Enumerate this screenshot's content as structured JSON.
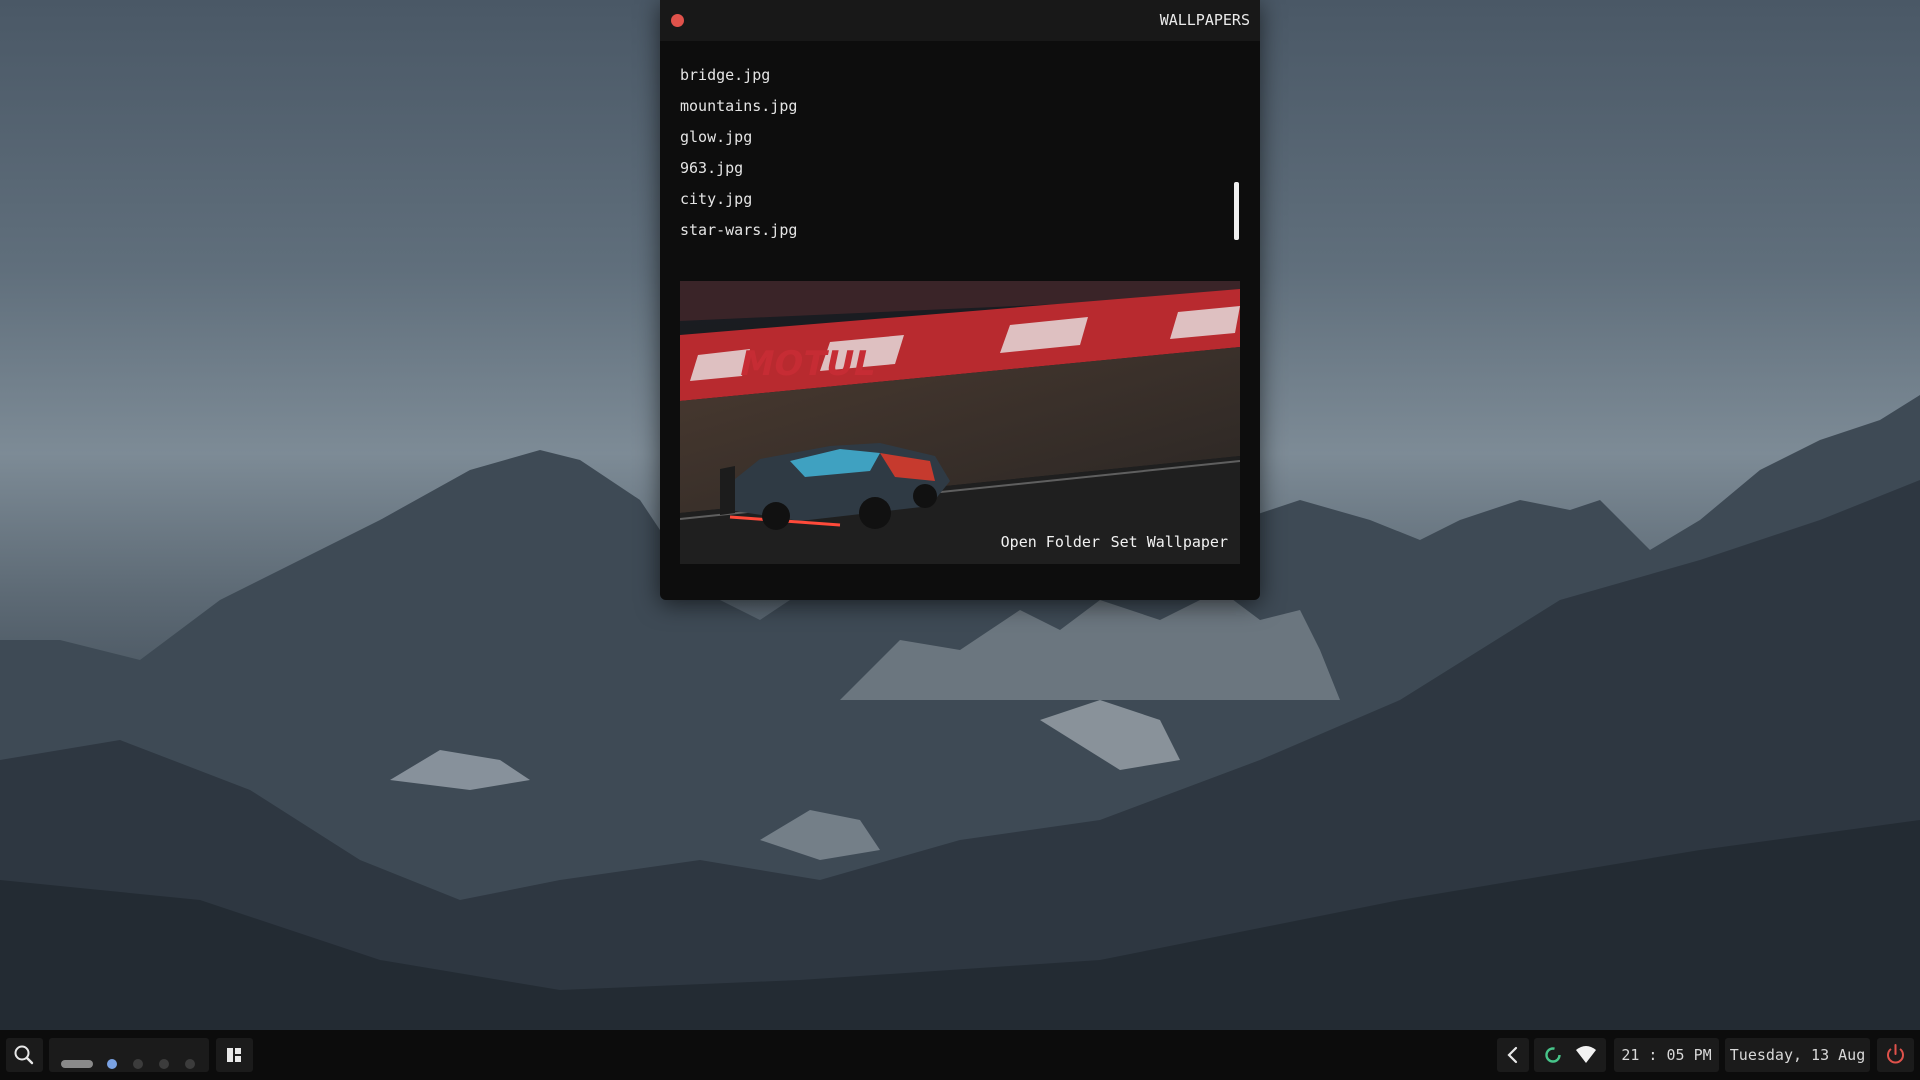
{
  "window": {
    "title": "WALLPAPERS",
    "files": [
      "bridge.jpg",
      "mountains.jpg",
      "glow.jpg",
      "963.jpg",
      "city.jpg",
      "star-wars.jpg"
    ],
    "preview": {
      "open_folder_label": "Open Folder",
      "set_wallpaper_label": "Set Wallpaper",
      "banner_text": "MOTUL"
    }
  },
  "taskbar": {
    "search_icon": "search-icon",
    "layout_icon": "layout-grid-icon",
    "tray_toggle_icon": "chevron-left-icon",
    "status_icon": "ring-icon",
    "wifi_icon": "wifi-icon",
    "time": "21 : 05 PM",
    "date": "Tuesday, 13 Aug",
    "power_icon": "power-icon"
  },
  "colors": {
    "close_button": "#e0524b",
    "workspace_active": "#7aa2e3",
    "status_ring": "#47c58a",
    "power": "#e0524b"
  }
}
